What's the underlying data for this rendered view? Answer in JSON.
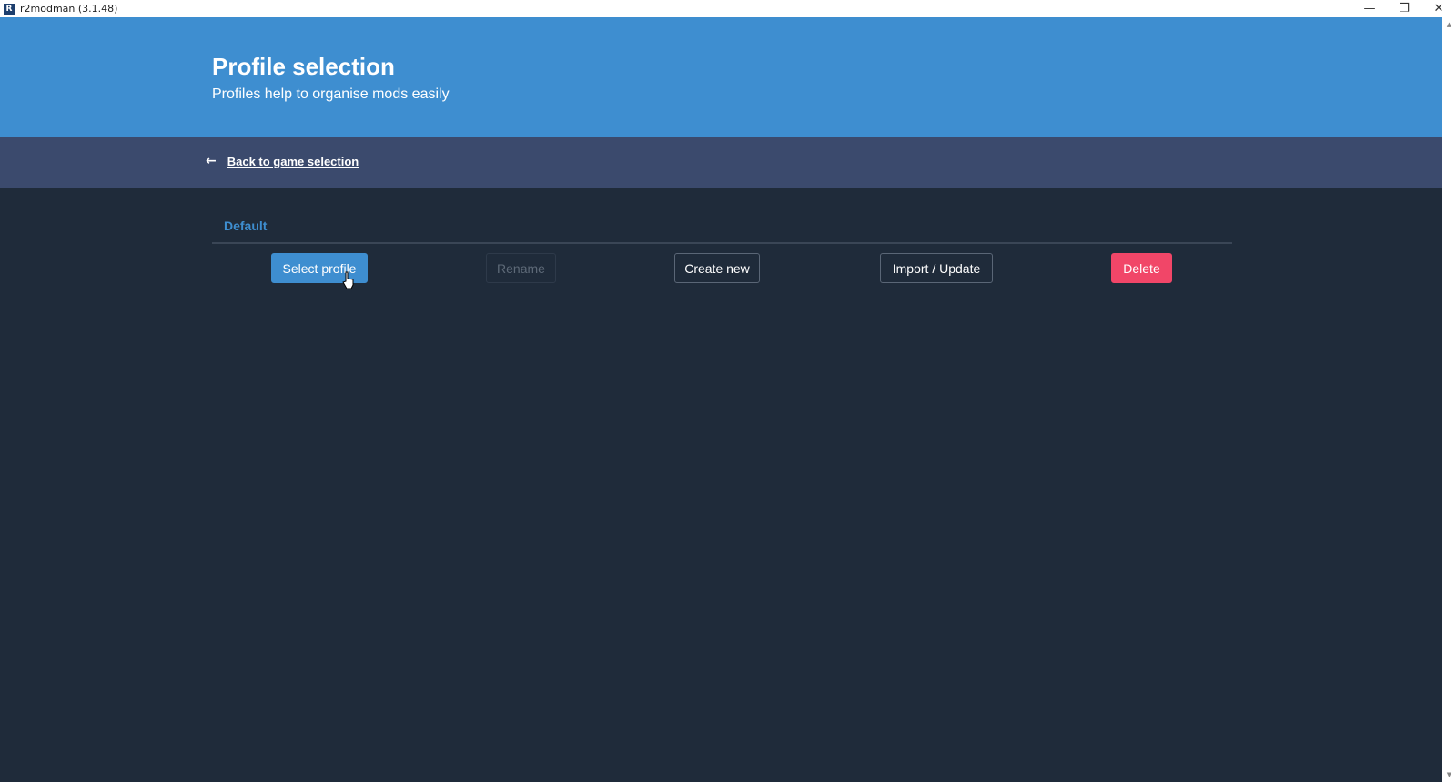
{
  "window": {
    "title": "r2modman (3.1.48)",
    "icon_letter": "R",
    "controls": {
      "minimize": "—",
      "maximize": "❐",
      "close": "✕"
    }
  },
  "hero": {
    "title": "Profile selection",
    "subtitle": "Profiles help to organise mods easily"
  },
  "nav": {
    "back_arrow": "←",
    "back_label": "Back to game selection"
  },
  "profiles": [
    {
      "name": "Default",
      "selected": true
    }
  ],
  "actions": {
    "select": "Select profile",
    "rename": "Rename",
    "create": "Create new",
    "import": "Import / Update",
    "delete": "Delete"
  },
  "scrollbar": {
    "up": "▲",
    "down": "▼"
  },
  "colors": {
    "primary": "#3e8ed0",
    "danger": "#f14668",
    "background": "#1f2b3a",
    "navbar": "#3b4a6d"
  }
}
